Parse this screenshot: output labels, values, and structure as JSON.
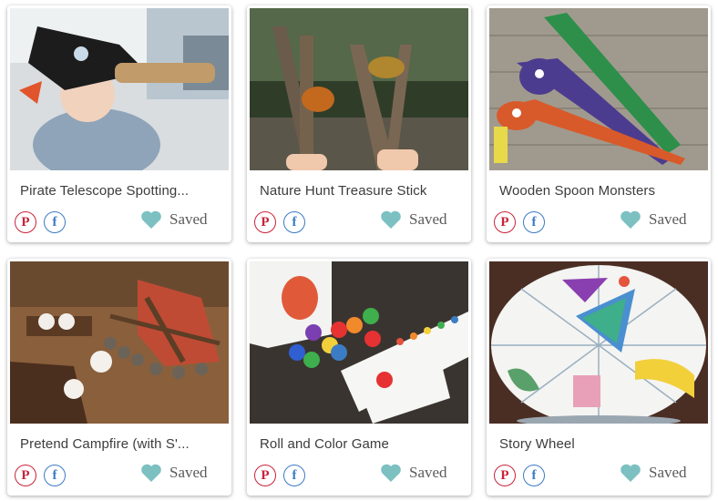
{
  "colors": {
    "heart": "#7cc0c2",
    "pinterest": "#c8233a",
    "facebook": "#3b7ac4"
  },
  "cards": [
    {
      "title": "Pirate Telescope Spotting...",
      "pin_icon": "pinterest-icon",
      "fb_icon": "facebook-icon",
      "saved_label": "Saved"
    },
    {
      "title": "Nature Hunt Treasure Stick",
      "pin_icon": "pinterest-icon",
      "fb_icon": "facebook-icon",
      "saved_label": "Saved"
    },
    {
      "title": "Wooden Spoon Monsters",
      "pin_icon": "pinterest-icon",
      "fb_icon": "facebook-icon",
      "saved_label": "Saved"
    },
    {
      "title": "Pretend Campfire (with S'...",
      "pin_icon": "pinterest-icon",
      "fb_icon": "facebook-icon",
      "saved_label": "Saved"
    },
    {
      "title": "Roll and Color Game",
      "pin_icon": "pinterest-icon",
      "fb_icon": "facebook-icon",
      "saved_label": "Saved"
    },
    {
      "title": "Story Wheel",
      "pin_icon": "pinterest-icon",
      "fb_icon": "facebook-icon",
      "saved_label": "Saved"
    }
  ]
}
